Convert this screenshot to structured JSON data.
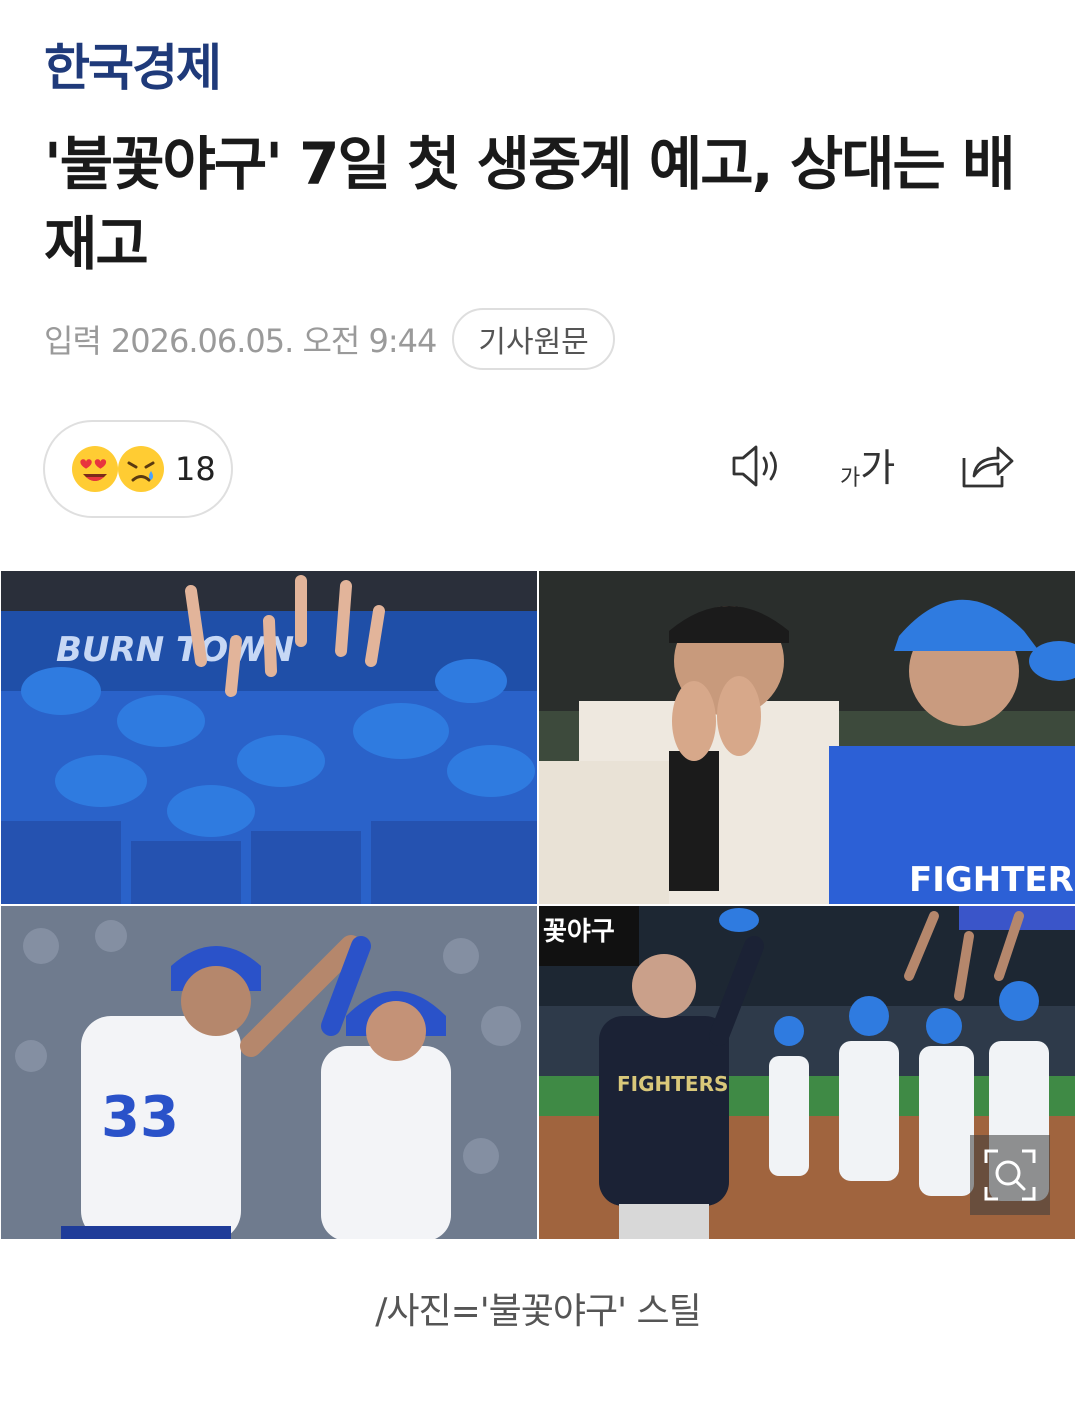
{
  "brand": {
    "name": "한국경제",
    "color": "#1f3a7a"
  },
  "article": {
    "title": "'불꽃야구' 7일 첫 생중계 예고, 상대는 배재고",
    "input_label": "입력",
    "date": "2026.06.05. 오전 9:44",
    "original_button": "기사원문"
  },
  "reactions": {
    "count": "18",
    "emojis": [
      "heart-eyes-emoji",
      "crying-emoji"
    ]
  },
  "toolbar": {
    "tts_icon": "speaker-icon",
    "font_small": "가",
    "font_big": "가",
    "share_icon": "share-icon"
  },
  "gallery": {
    "photos": [
      {
        "label": "burn-town-team-huddle"
      },
      {
        "label": "coach-high-five-fighters"
      },
      {
        "label": "batter-high-five-33"
      },
      {
        "label": "coach-waving-cap-stadium"
      }
    ],
    "banner_text": "BURN TOWN",
    "jersey_text": "FIGHTERS",
    "scoreboard_text": "꽃야구",
    "zoom_icon": "zoom-search-icon"
  },
  "caption": "/사진='불꽃야구' 스틸"
}
